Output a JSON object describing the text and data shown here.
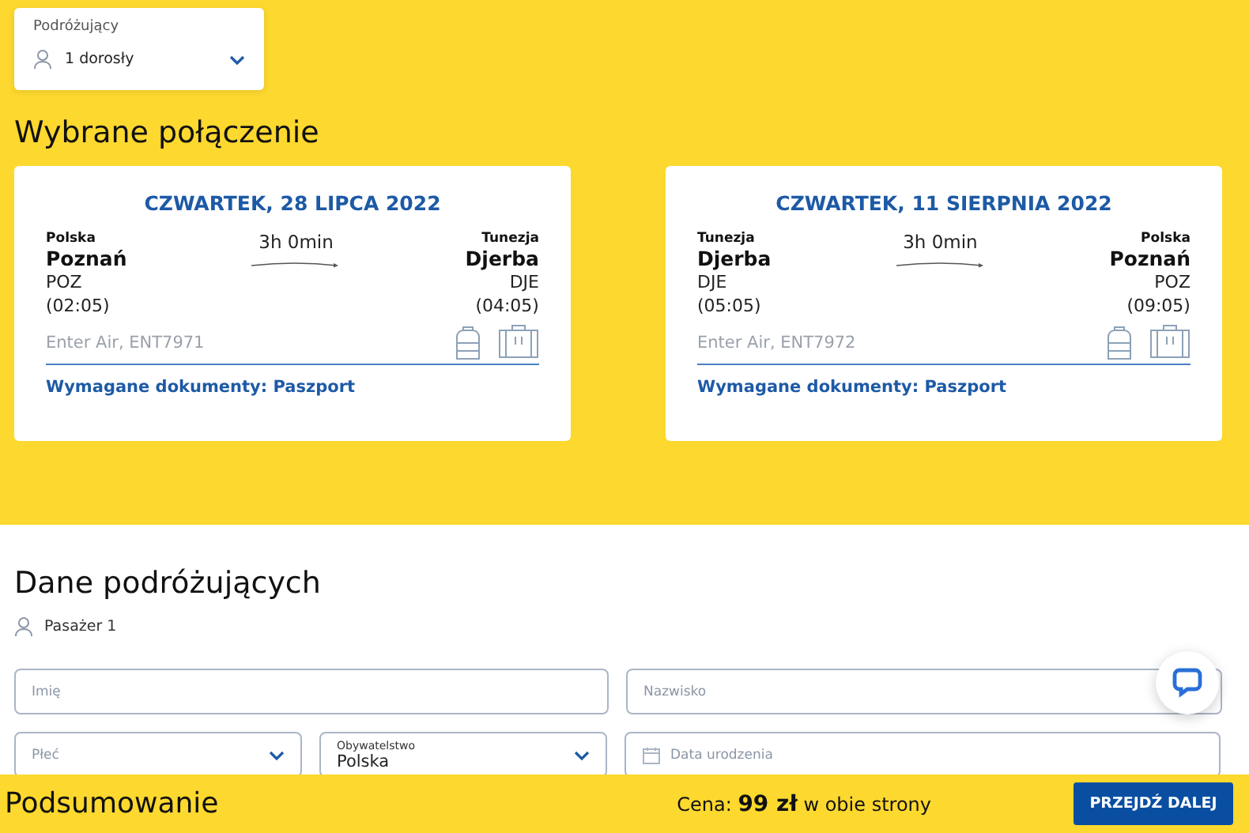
{
  "travelers": {
    "label": "Podróżujący",
    "value": "1 dorosły"
  },
  "selected_heading": "Wybrane połączenie",
  "flights": [
    {
      "date": "CZWARTEK, 28 LIPCA 2022",
      "duration": "3h 0min",
      "from": {
        "country": "Polska",
        "city": "Poznań",
        "code": "POZ",
        "time": "(02:05)"
      },
      "to": {
        "country": "Tunezja",
        "city": "Djerba",
        "code": "DJE",
        "time": "(04:05)"
      },
      "flight": "Enter Air, ENT7971",
      "documents": "Wymagane dokumenty: Paszport"
    },
    {
      "date": "CZWARTEK, 11 SIERPNIA 2022",
      "duration": "3h 0min",
      "from": {
        "country": "Tunezja",
        "city": "Djerba",
        "code": "DJE",
        "time": "(05:05)"
      },
      "to": {
        "country": "Polska",
        "city": "Poznań",
        "code": "POZ",
        "time": "(09:05)"
      },
      "flight": "Enter Air, ENT7972",
      "documents": "Wymagane dokumenty: Paszport"
    }
  ],
  "passengers_heading": "Dane podróżujących",
  "passenger": "Pasażer 1",
  "fields": [
    {
      "kind": "text",
      "placeholder": "Imię"
    },
    {
      "kind": "text",
      "placeholder": "Nazwisko"
    },
    {
      "kind": "select",
      "placeholder": "Płeć"
    },
    {
      "kind": "select",
      "label": "Obywatelstwo",
      "value": "Polska"
    },
    {
      "kind": "date",
      "placeholder": "Data urodzenia"
    }
  ],
  "footer": {
    "title": "Podsumowanie",
    "price": "Cena: **99 zł** w obie strony",
    "button": "PRZEJDŹ DALEJ"
  }
}
